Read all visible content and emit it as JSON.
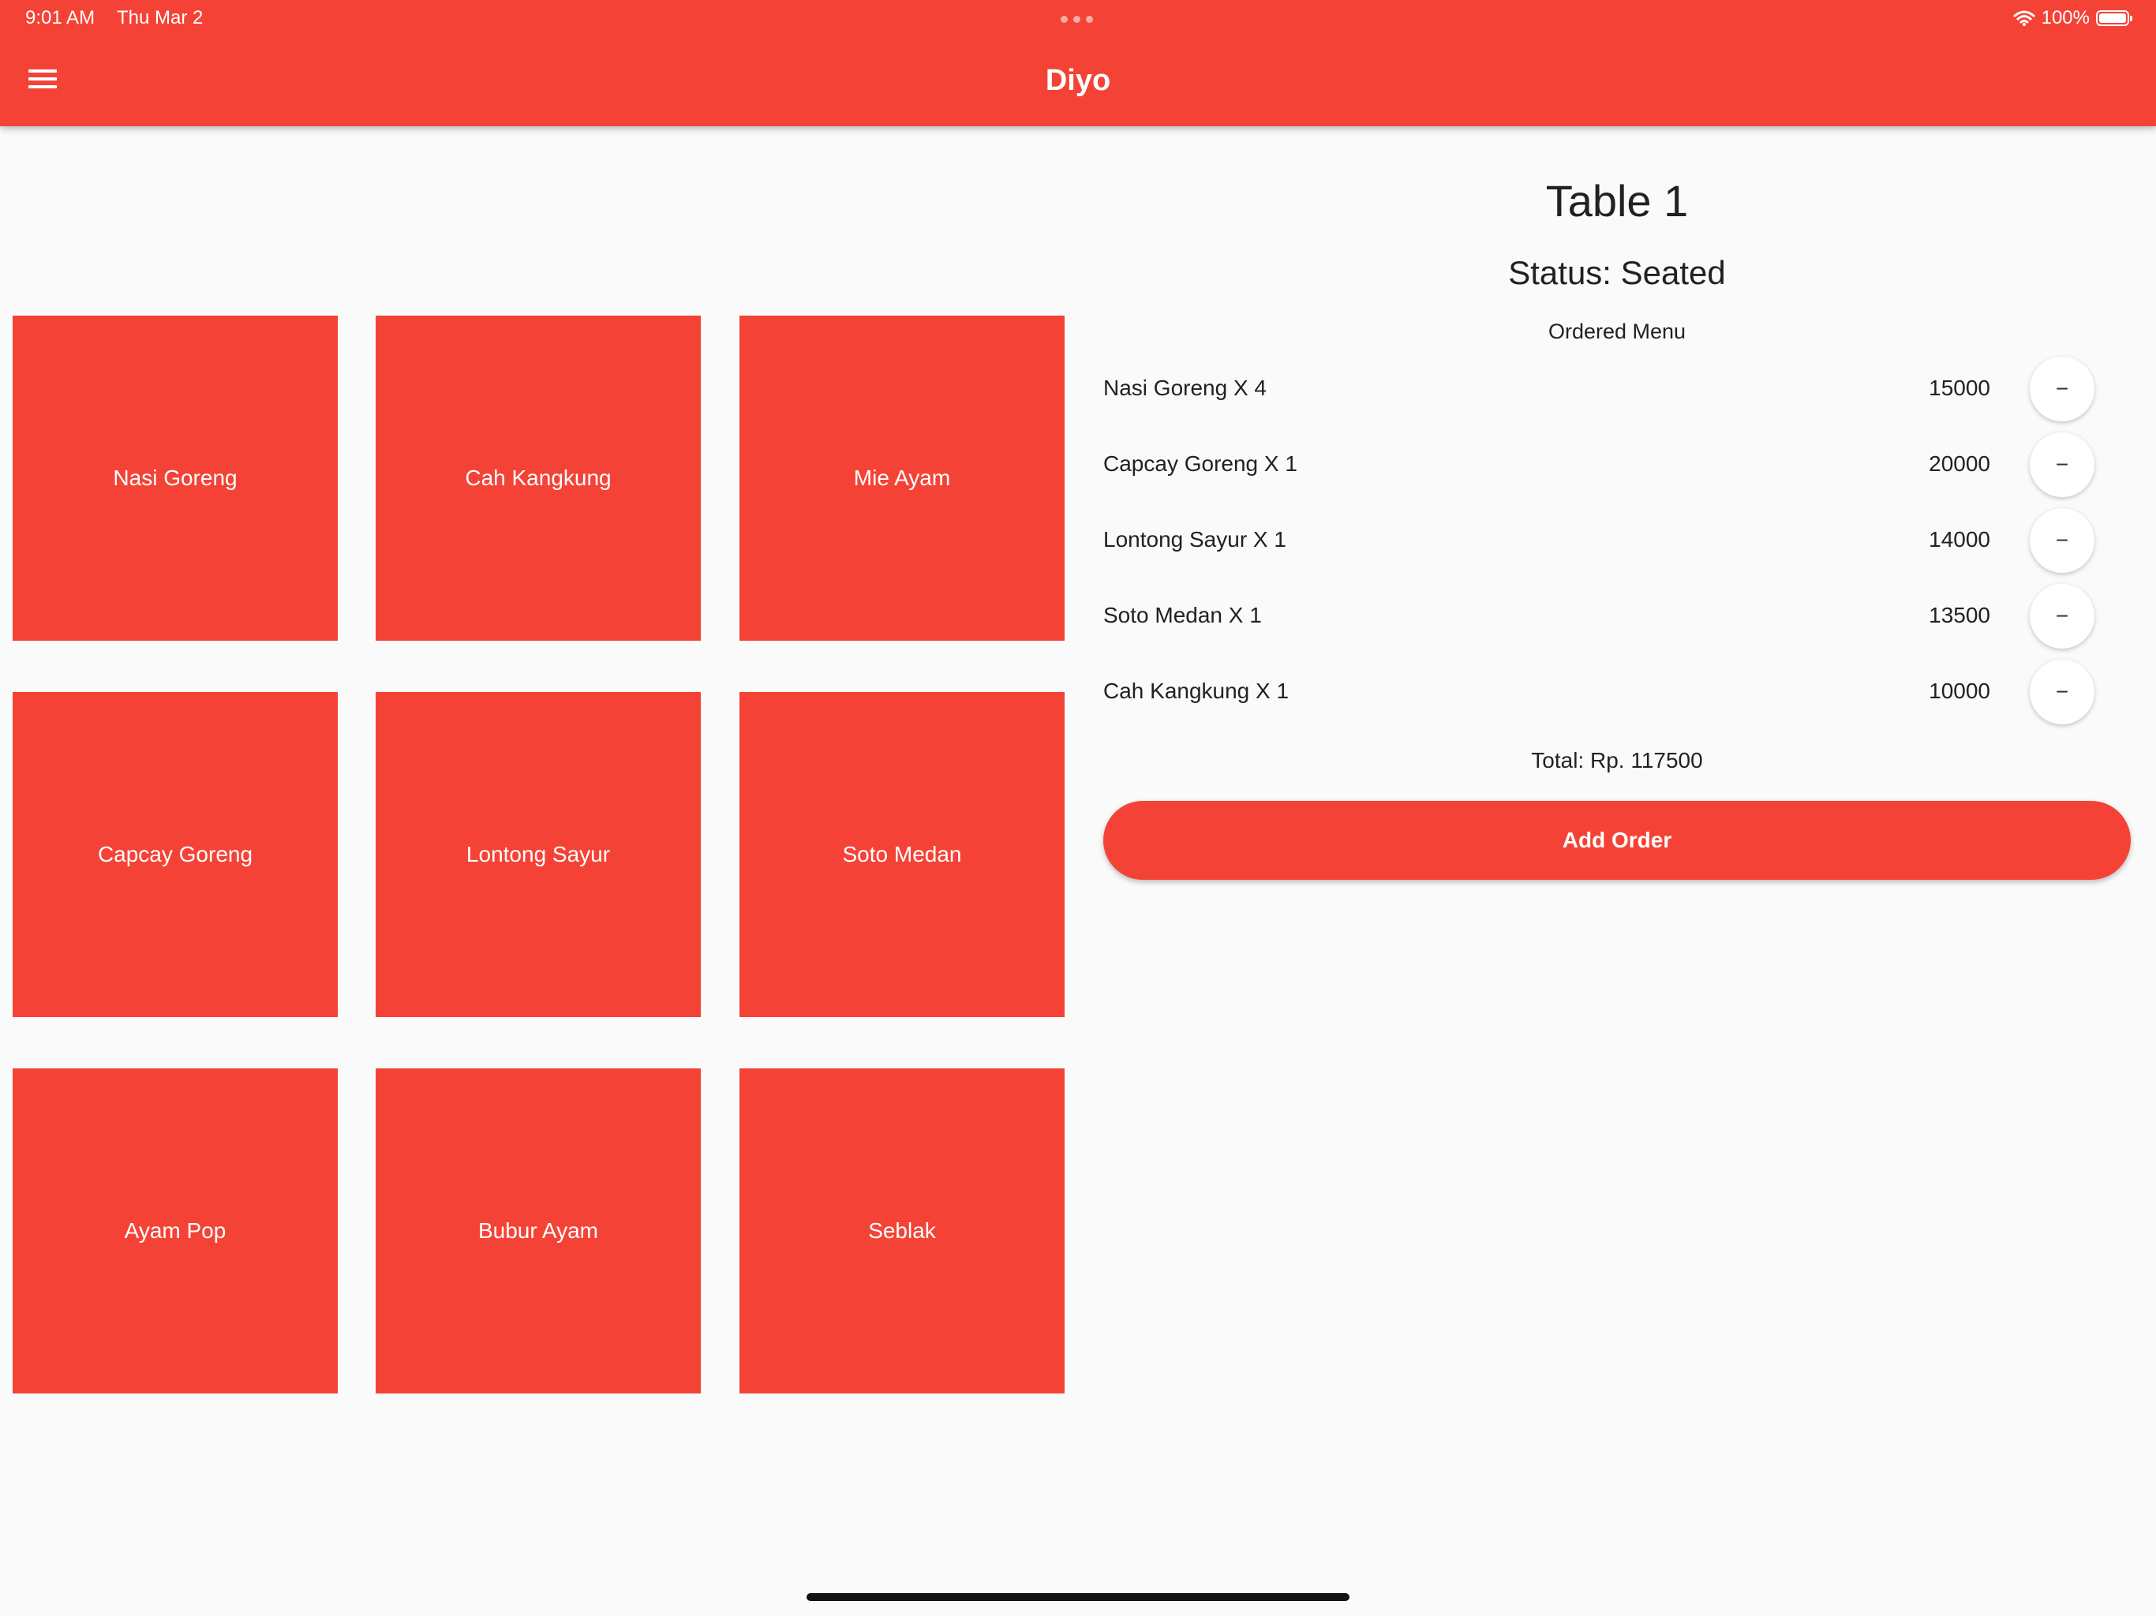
{
  "status_bar": {
    "time": "9:01 AM",
    "date": "Thu Mar 2",
    "battery_percent": "100%",
    "icons": [
      "wifi-icon",
      "battery-icon"
    ]
  },
  "app_bar": {
    "title": "Diyo",
    "menu_icon": "menu-icon"
  },
  "menu": {
    "items": [
      {
        "label": "Nasi Goreng"
      },
      {
        "label": "Cah Kangkung"
      },
      {
        "label": "Mie Ayam"
      },
      {
        "label": "Capcay Goreng"
      },
      {
        "label": "Lontong Sayur"
      },
      {
        "label": "Soto Medan"
      },
      {
        "label": "Ayam Pop"
      },
      {
        "label": "Bubur Ayam"
      },
      {
        "label": "Seblak"
      }
    ]
  },
  "order": {
    "table_title": "Table 1",
    "status": "Status: Seated",
    "heading": "Ordered Menu",
    "items": [
      {
        "name": "Nasi Goreng X 4",
        "price": "15000",
        "remove_label": "−"
      },
      {
        "name": "Capcay Goreng X 1",
        "price": "20000",
        "remove_label": "−"
      },
      {
        "name": "Lontong Sayur X 1",
        "price": "14000",
        "remove_label": "−"
      },
      {
        "name": "Soto Medan X 1",
        "price": "13500",
        "remove_label": "−"
      },
      {
        "name": "Cah Kangkung X 1",
        "price": "10000",
        "remove_label": "−"
      }
    ],
    "total": "Total: Rp. 117500",
    "add_order_label": "Add Order"
  },
  "colors": {
    "accent": "#f44336",
    "background": "#fafafa",
    "text": "#212121"
  }
}
